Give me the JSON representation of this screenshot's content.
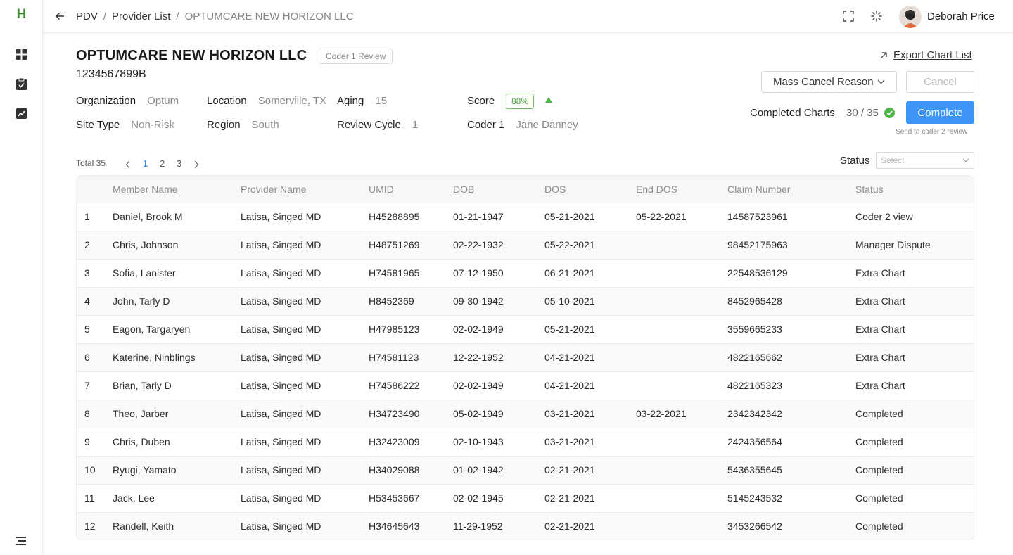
{
  "app": {
    "logo": "H"
  },
  "header": {
    "breadcrumbs": [
      "PDV",
      "Provider List",
      "OPTUMCARE NEW HORIZON LLC"
    ],
    "user_name": "Deborah Price"
  },
  "provider": {
    "name": "OPTUMCARE NEW HORIZON LLC",
    "review_tag": "Coder 1 Review",
    "id": "1234567899B",
    "organization_label": "Organization",
    "organization": "Optum",
    "location_label": "Location",
    "location": "Somerville, TX",
    "aging_label": "Aging",
    "aging": "15",
    "score_label": "Score",
    "score": "88%",
    "site_type_label": "Site Type",
    "site_type": "Non-Risk",
    "region_label": "Region",
    "region": "South",
    "review_cycle_label": "Review Cycle",
    "review_cycle": "1",
    "coder_label": "Coder 1",
    "coder": "Jane Danney"
  },
  "actions": {
    "export_label": "Export Chart List",
    "mass_cancel_label": "Mass Cancel Reason",
    "cancel_label": "Cancel",
    "completed_charts_label": "Completed Charts",
    "completed_charts_value": "30 / 35",
    "complete_label": "Complete",
    "send_note": "Send to coder 2 review"
  },
  "pagination": {
    "total": "Total 35",
    "pages": [
      "1",
      "2",
      "3"
    ],
    "current": "1"
  },
  "filter": {
    "status_label": "Status",
    "status_placeholder": "Select"
  },
  "colors": {
    "accent": "#3c95f5",
    "brand": "#3f8f34",
    "success": "#52b54a"
  },
  "table": {
    "columns": [
      "",
      "Member Name",
      "Provider Name",
      "UMID",
      "DOB",
      "DOS",
      "End DOS",
      "Claim Number",
      "Status"
    ],
    "rows": [
      [
        "1",
        "Daniel, Brook M",
        "Latisa, Singed MD",
        "H45288895",
        "01-21-1947",
        "05-21-2021",
        "05-22-2021",
        "14587523961",
        "Coder 2 view"
      ],
      [
        "2",
        "Chris, Johnson",
        "Latisa, Singed MD",
        "H48751269",
        "02-22-1932",
        "05-22-2021",
        "",
        "98452175963",
        "Manager Dispute"
      ],
      [
        "3",
        "Sofia, Lanister",
        "Latisa, Singed MD",
        "H74581965",
        "07-12-1950",
        "06-21-2021",
        "",
        "22548536129",
        "Extra Chart"
      ],
      [
        "4",
        "John, Tarly D",
        "Latisa, Singed MD",
        "H8452369",
        "09-30-1942",
        "05-10-2021",
        "",
        "8452965428",
        "Extra Chart"
      ],
      [
        "5",
        "Eagon, Targaryen",
        "Latisa, Singed MD",
        "H47985123",
        "02-02-1949",
        "05-21-2021",
        "",
        "3559665233",
        "Extra Chart"
      ],
      [
        "6",
        "Katerine, Ninblings",
        "Latisa, Singed MD",
        "H74581123",
        "12-22-1952",
        "04-21-2021",
        "",
        "4822165662",
        "Extra Chart"
      ],
      [
        "7",
        "Brian, Tarly D",
        "Latisa, Singed MD",
        "H74586222",
        "02-02-1949",
        "04-21-2021",
        "",
        "4822165323",
        "Extra Chart"
      ],
      [
        "8",
        "Theo, Jarber",
        "Latisa, Singed MD",
        "H34723490",
        "05-02-1949",
        "03-21-2021",
        "03-22-2021",
        "2342342342",
        "Completed"
      ],
      [
        "9",
        "Chris, Duben",
        "Latisa, Singed MD",
        "H32423009",
        "02-10-1943",
        "03-21-2021",
        "",
        "2424356564",
        "Completed"
      ],
      [
        "10",
        "Ryugi, Yamato",
        "Latisa, Singed MD",
        "H34029088",
        "01-02-1942",
        "02-21-2021",
        "",
        "5436355645",
        "Completed"
      ],
      [
        "11",
        "Jack, Lee",
        "Latisa, Singed MD",
        "H53453667",
        "02-02-1945",
        "02-21-2021",
        "",
        "5145243532",
        "Completed"
      ],
      [
        "12",
        "Randell, Keith",
        "Latisa, Singed MD",
        "H34645643",
        "11-29-1952",
        "02-21-2021",
        "",
        "3453266542",
        "Completed"
      ]
    ]
  }
}
